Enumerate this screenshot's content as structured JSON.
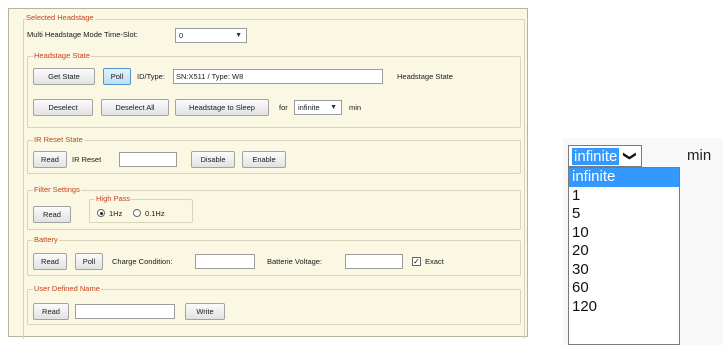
{
  "selected_headstage": {
    "legend": "Selected Headstage",
    "mode_label": "Multi Headstage Mode Time-Slot:",
    "mode_value": "0"
  },
  "headstage_state": {
    "legend": "Headstage State",
    "get_state": "Get State",
    "poll": "Poll",
    "id_label": "ID/Type:",
    "id_value": "SN:X511 / Type: W8",
    "status_label": "Headstage State",
    "deselect": "Deselect",
    "deselect_all": "Deselect All",
    "sleep": "Headstage to Sleep",
    "for_label": "for",
    "sleep_value": "infinite",
    "min_label": "min"
  },
  "ir_reset": {
    "legend": "IR Reset State",
    "read": "Read",
    "label": "IR Reset",
    "value": "",
    "disable": "Disable",
    "enable": "Enable"
  },
  "filter": {
    "legend": "Filter Settings",
    "read": "Read",
    "highpass_legend": "High Pass",
    "opt1": "1Hz",
    "opt2": "0.1Hz"
  },
  "battery": {
    "legend": "Battery",
    "read": "Read",
    "poll": "Poll",
    "charge_label": "Charge Condition:",
    "charge_value": "",
    "voltage_label": "Batterie Voltage:",
    "voltage_value": "",
    "exact_label": "Exact"
  },
  "user_name": {
    "legend": "User Defined Name",
    "read": "Read",
    "value": "",
    "write": "Write"
  },
  "zoom": {
    "selected": "infinite",
    "min_label": "min",
    "options": [
      "infinite",
      "1",
      "5",
      "10",
      "20",
      "30",
      "60",
      "120"
    ]
  },
  "colors": {
    "legend": "#c8431e",
    "selection": "#3399ff",
    "panel": "#faf7e3"
  }
}
